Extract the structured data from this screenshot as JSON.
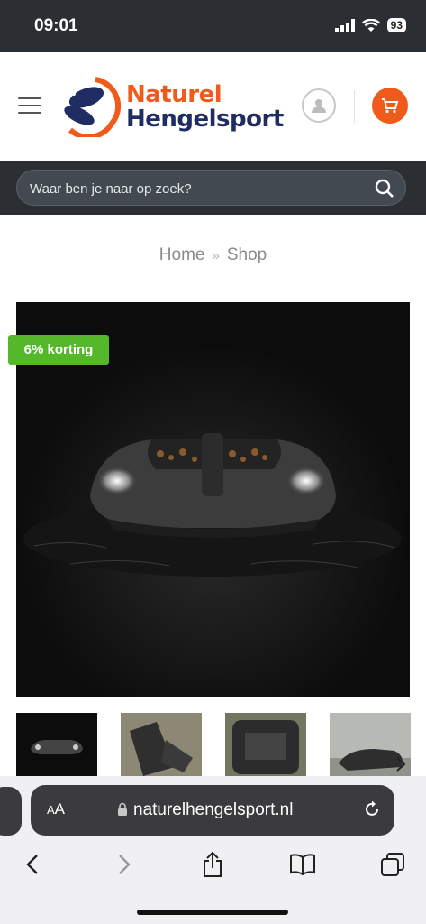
{
  "status_bar": {
    "time": "09:01",
    "battery": "93"
  },
  "header": {
    "logo_line1": "Naturel",
    "logo_line2": "Hengelsport",
    "brand_colors": {
      "orange": "#f05a1a",
      "navy": "#1f2d63"
    }
  },
  "search": {
    "placeholder": "Waar ben je naar op zoek?"
  },
  "breadcrumb": {
    "home": "Home",
    "separator": "»",
    "current": "Shop"
  },
  "product": {
    "discount_badge": "6% korting",
    "badge_color": "#55b82b"
  },
  "browser": {
    "aa_small": "A",
    "aa_large": "A",
    "url": "naturelhengelsport.nl"
  },
  "icons": {
    "menu": "hamburger-icon",
    "account": "user-icon",
    "cart": "cart-icon",
    "search": "search-icon",
    "lock": "lock-icon",
    "reload": "reload-icon",
    "back": "back-icon",
    "forward": "forward-icon",
    "share": "share-icon",
    "bookmarks": "book-icon",
    "tabs": "tabs-icon",
    "next": "chevron-right-icon"
  }
}
